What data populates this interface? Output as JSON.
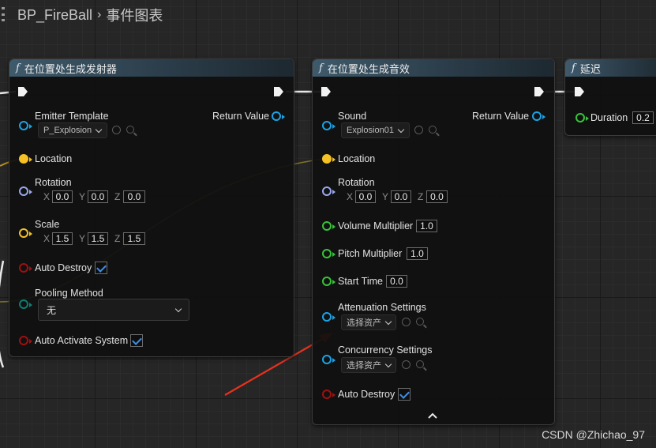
{
  "breadcrumb": {
    "blueprint": "BP_FireBall",
    "graph": "事件图表"
  },
  "node1": {
    "title": "在位置处生成发射器",
    "emitter_template_label": "Emitter Template",
    "emitter_template_value": "P_Explosion",
    "return_value_label": "Return Value",
    "location_label": "Location",
    "rotation_label": "Rotation",
    "rotation": {
      "x": "0.0",
      "y": "0.0",
      "z": "0.0"
    },
    "scale_label": "Scale",
    "scale": {
      "x": "1.5",
      "y": "1.5",
      "z": "1.5"
    },
    "auto_destroy_label": "Auto Destroy",
    "auto_destroy": true,
    "pooling_method_label": "Pooling Method",
    "pooling_method_value": "无",
    "auto_activate_label": "Auto Activate System",
    "auto_activate": true
  },
  "node2": {
    "title": "在位置处生成音效",
    "sound_label": "Sound",
    "sound_value": "Explosion01",
    "return_value_label": "Return Value",
    "location_label": "Location",
    "rotation_label": "Rotation",
    "rotation": {
      "x": "0.0",
      "y": "0.0",
      "z": "0.0"
    },
    "volume_label": "Volume Multiplier",
    "volume_value": "1.0",
    "pitch_label": "Pitch Multiplier",
    "pitch_value": "1.0",
    "start_time_label": "Start Time",
    "start_time_value": "0.0",
    "attenuation_label": "Attenuation Settings",
    "attenuation_value": "选择资产",
    "concurrency_label": "Concurrency Settings",
    "concurrency_value": "选择资产",
    "auto_destroy_label": "Auto Destroy",
    "auto_destroy": true
  },
  "node3": {
    "title": "延迟",
    "duration_label": "Duration",
    "duration_value": "0.2"
  },
  "axis_labels": {
    "x": "X",
    "y": "Y",
    "z": "Z"
  },
  "watermark": "CSDN @Zhichao_97",
  "colors": {
    "exec": "#ffffff",
    "object_pin": "#1aa3e8",
    "vector_pin": "#f5c125",
    "rotator_pin": "#9aa8ec",
    "float_pin": "#37c43a",
    "bool_pin": "#a01010",
    "enum_pin": "#0d7e72",
    "annotation_arrow": "#e8311e"
  }
}
